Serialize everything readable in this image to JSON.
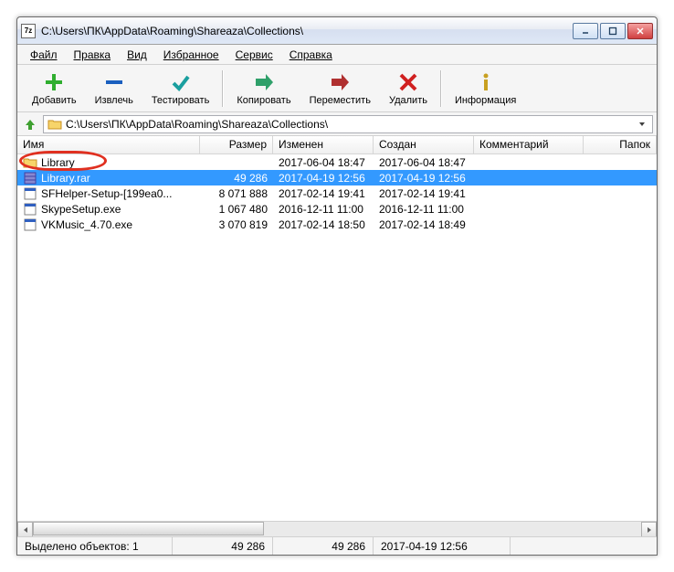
{
  "title": "C:\\Users\\ПК\\AppData\\Roaming\\Shareaza\\Collections\\",
  "app_icon_label": "7z",
  "menu": {
    "file": "Файл",
    "edit": "Правка",
    "view": "Вид",
    "favorites": "Избранное",
    "tools": "Сервис",
    "help": "Справка"
  },
  "toolbar": {
    "add": "Добавить",
    "extract": "Извлечь",
    "test": "Тестировать",
    "copy": "Копировать",
    "move": "Переместить",
    "delete": "Удалить",
    "info": "Информация"
  },
  "address": {
    "path": "C:\\Users\\ПК\\AppData\\Roaming\\Shareaza\\Collections\\"
  },
  "columns": {
    "name": "Имя",
    "size": "Размер",
    "modified": "Изменен",
    "created": "Создан",
    "comment": "Комментарий",
    "folders": "Папок"
  },
  "col_widths": {
    "name": 200,
    "size": 80,
    "modified": 110,
    "created": 110,
    "comment": 120,
    "folders": 60
  },
  "rows": [
    {
      "icon": "folder",
      "name": "Library",
      "size": "",
      "modified": "2017-06-04 18:47",
      "created": "2017-06-04 18:47",
      "selected": false,
      "highlighted": true
    },
    {
      "icon": "archive",
      "name": "Library.rar",
      "size": "49 286",
      "modified": "2017-04-19 12:56",
      "created": "2017-04-19 12:56",
      "selected": true,
      "highlighted": false
    },
    {
      "icon": "exe",
      "name": "SFHelper-Setup-[199ea0...",
      "size": "8 071 888",
      "modified": "2017-02-14 19:41",
      "created": "2017-02-14 19:41",
      "selected": false,
      "highlighted": false
    },
    {
      "icon": "exe",
      "name": "SkypeSetup.exe",
      "size": "1 067 480",
      "modified": "2016-12-11 11:00",
      "created": "2016-12-11 11:00",
      "selected": false,
      "highlighted": false
    },
    {
      "icon": "exe",
      "name": "VKMusic_4.70.exe",
      "size": "3 070 819",
      "modified": "2017-02-14 18:50",
      "created": "2017-02-14 18:49",
      "selected": false,
      "highlighted": false
    }
  ],
  "status": {
    "label": "Выделено объектов: 1",
    "size": "49 286",
    "size2": "49 286",
    "date": "2017-04-19 12:56"
  }
}
